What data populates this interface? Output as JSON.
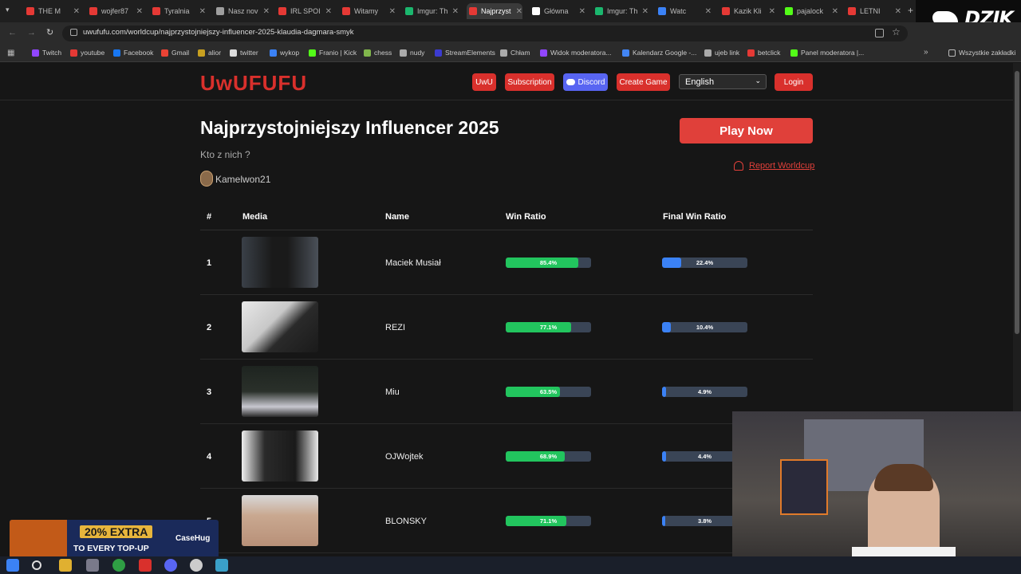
{
  "browser": {
    "tabs": [
      {
        "label": "THE M",
        "color": "#e53935"
      },
      {
        "label": "wojfer87",
        "color": "#e53935"
      },
      {
        "label": "Tyralnia",
        "color": "#e53935"
      },
      {
        "label": "Nasz nov",
        "color": "#9e9e9e"
      },
      {
        "label": "IRL SPOI",
        "color": "#e53935"
      },
      {
        "label": "Witamy",
        "color": "#e53935"
      },
      {
        "label": "Imgur: Th",
        "color": "#1bb76e"
      },
      {
        "label": "Najprzyst",
        "color": "#e53935"
      },
      {
        "label": "Główna",
        "color": "#ffffff"
      },
      {
        "label": "Imgur: Th",
        "color": "#1bb76e"
      },
      {
        "label": "Watc",
        "color": "#3b82f6"
      },
      {
        "label": "Kazik Kli",
        "color": "#e53935"
      },
      {
        "label": "pajalock",
        "color": "#53fc18"
      },
      {
        "label": "LETNI",
        "color": "#e53935"
      }
    ],
    "active_tab": 7,
    "url": "uwufufu.com/worldcup/najprzystojniejszy-influencer-2025-klaudia-dagmara-smyk",
    "bookmarks": [
      {
        "label": "Twitch",
        "color": "#9146ff"
      },
      {
        "label": "youtube",
        "color": "#e53935"
      },
      {
        "label": "Facebook",
        "color": "#1877f2"
      },
      {
        "label": "Gmail",
        "color": "#ea4335"
      },
      {
        "label": "alior",
        "color": "#c8a020"
      },
      {
        "label": "twitter",
        "color": "#dddddd"
      },
      {
        "label": "wykop",
        "color": "#3b82f6"
      },
      {
        "label": "Franio | Kick",
        "color": "#53fc18"
      },
      {
        "label": "chess",
        "color": "#81b64c"
      },
      {
        "label": "nudy",
        "color": "#aaaaaa"
      },
      {
        "label": "StreamElements",
        "color": "#3b3bd0"
      },
      {
        "label": "Chłam",
        "color": "#aaaaaa"
      },
      {
        "label": "Widok moderatora...",
        "color": "#9146ff"
      },
      {
        "label": "Kalendarz Google -...",
        "color": "#4285f4"
      },
      {
        "label": "ujeb link",
        "color": "#aaaaaa"
      },
      {
        "label": "betclick",
        "color": "#e53935"
      },
      {
        "label": "Panel moderatora |...",
        "color": "#53fc18"
      }
    ],
    "all_bookmarks": "Wszystkie zakładki",
    "overlay_brand": "DZIK"
  },
  "nav": {
    "logo": "UwUFUFU",
    "uwu": "UwU",
    "subscription": "Subscription",
    "discord": "Discord",
    "create_game": "Create Game",
    "language": "English",
    "login": "Login"
  },
  "worldcup": {
    "title": "Najprzystojniejszy Influencer 2025",
    "subtitle": "Kto z nich ?",
    "author": "Kamelwon21",
    "play": "Play Now",
    "report": "Report Worldcup"
  },
  "table": {
    "headers": {
      "rank": "#",
      "media": "Media",
      "name": "Name",
      "win": "Win Ratio",
      "final": "Final Win Ratio"
    },
    "rows": [
      {
        "rank": "1",
        "name": "Maciek Musiał",
        "win": 85.4,
        "win_label": "85.4%",
        "final": 22.4,
        "final_label": "22.4%"
      },
      {
        "rank": "2",
        "name": "REZI",
        "win": 77.1,
        "win_label": "77.1%",
        "final": 10.4,
        "final_label": "10.4%"
      },
      {
        "rank": "3",
        "name": "Miu",
        "win": 63.5,
        "win_label": "63.5%",
        "final": 4.9,
        "final_label": "4.9%"
      },
      {
        "rank": "4",
        "name": "OJWojtek",
        "win": 68.9,
        "win_label": "68.9%",
        "final": 4.4,
        "final_label": "4.4%"
      },
      {
        "rank": "5",
        "name": "BLONSKY",
        "win": 71.1,
        "win_label": "71.1%",
        "final": 3.8,
        "final_label": "3.8%"
      }
    ]
  },
  "colors": {
    "accent": "#d9302c",
    "win_bar": "#22c55e",
    "final_bar": "#3b82f6",
    "bar_track": "#3a4556",
    "discord": "#5865f2"
  },
  "promo": {
    "line1": "20% EXTRA",
    "line2": "TO EVERY TOP-UP",
    "brand": "CaseHug"
  }
}
